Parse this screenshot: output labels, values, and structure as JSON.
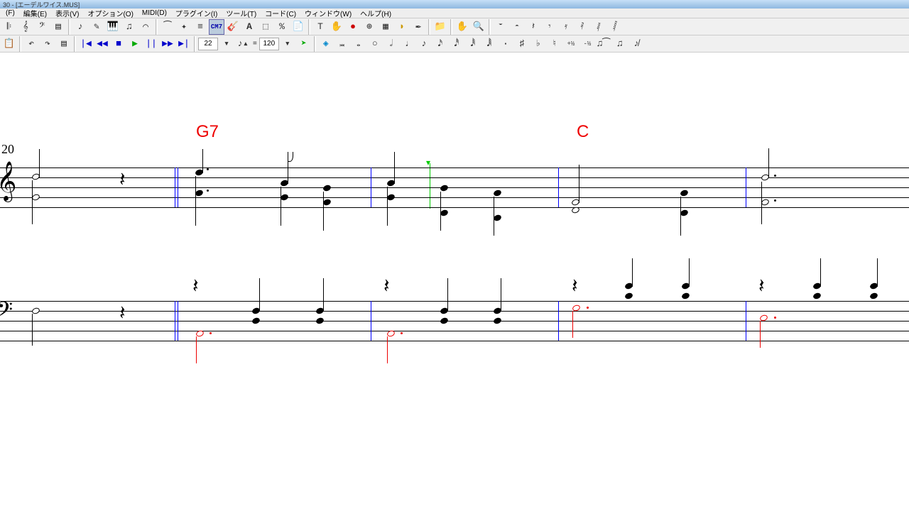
{
  "title": "30 - [エーデルワイス.MUS]",
  "menu": {
    "file": "(F)",
    "edit": "編集(E)",
    "view": "表示(V)",
    "option": "オプション(O)",
    "midi": "MIDI(D)",
    "plugin": "プラグイン(I)",
    "tool": "ツール(T)",
    "code": "コード(C)",
    "window": "ウィンドウ(W)",
    "help": "ヘルプ(H)"
  },
  "toolbar1": {
    "measure_input": "22",
    "tempo_input": "120",
    "chord_btn": "CM7",
    "text_btn": "A",
    "percent_btn": "%"
  },
  "toolbar2": {
    "tempo": "120"
  },
  "score": {
    "tempo_mark": "20",
    "chord_g7": "G7",
    "chord_c": "C"
  }
}
